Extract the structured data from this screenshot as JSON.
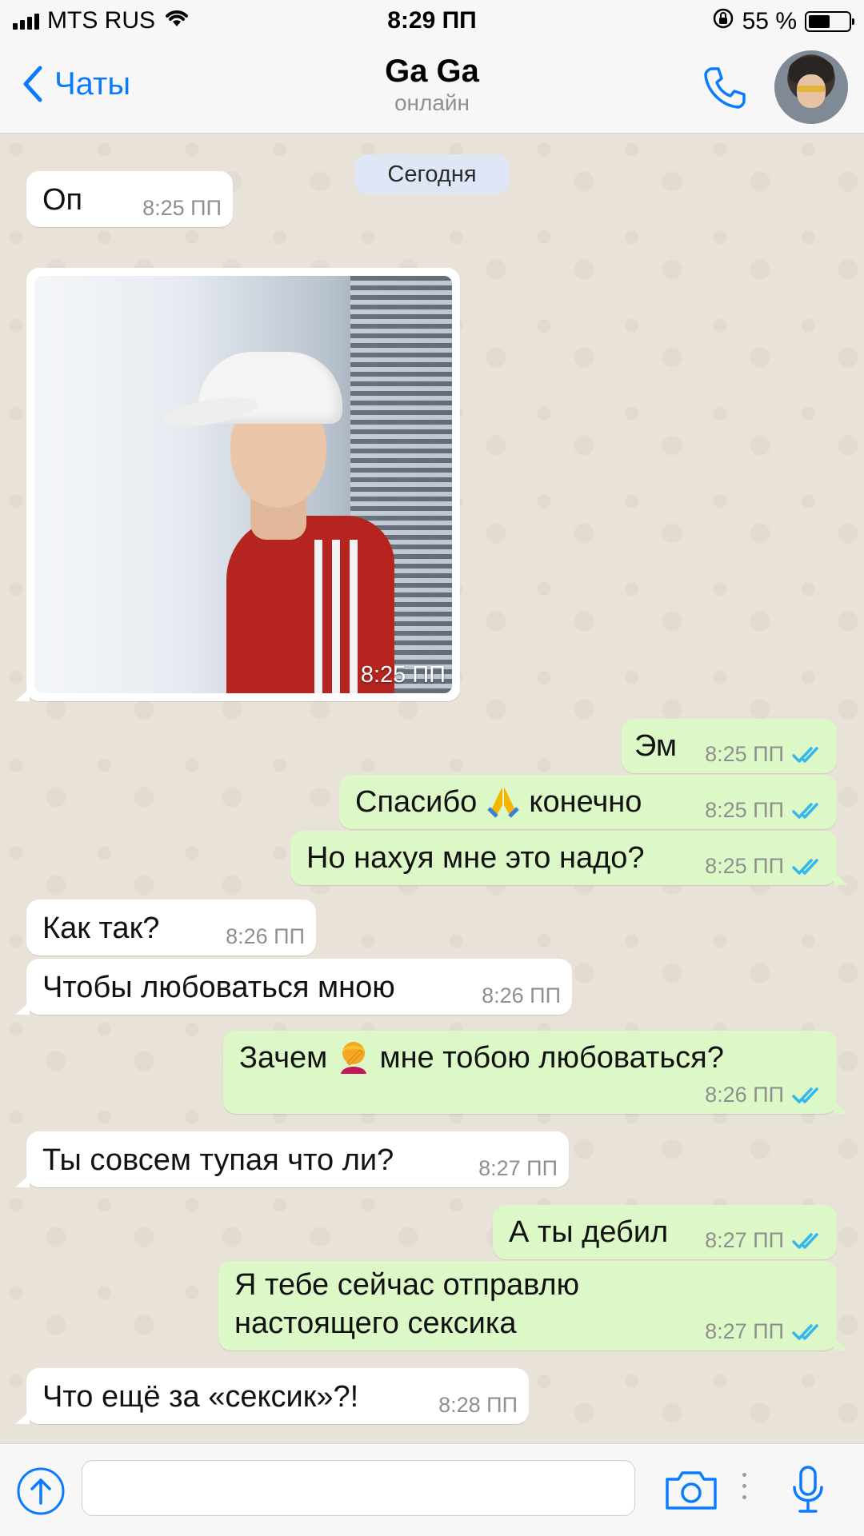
{
  "status_bar": {
    "carrier": "MTS RUS",
    "time": "8:29 ПП",
    "battery_text": "55 %",
    "battery_level": 0.55
  },
  "header": {
    "back_label": "Чаты",
    "chat_name": "Ga Ga",
    "chat_status": "онлайн",
    "icons": [
      "chevron-left-icon",
      "phone-icon",
      "avatar"
    ]
  },
  "chat": {
    "date_separator": "Сегодня",
    "messages": [
      {
        "dir": "in",
        "type": "text",
        "text": "Оп",
        "time": "8:25 ПП"
      },
      {
        "dir": "in",
        "type": "photo",
        "time": "8:25 ПП"
      },
      {
        "dir": "out",
        "type": "text",
        "text": "Эм",
        "time": "8:25 ПП",
        "read": true
      },
      {
        "dir": "out",
        "type": "text",
        "text_before": "Спасибо",
        "emoji": "folded-hands",
        "text_after": "конечно",
        "time": "8:25 ПП",
        "read": true
      },
      {
        "dir": "out",
        "type": "text",
        "text": "Но нахуя мне это надо?",
        "time": "8:25 ПП",
        "read": true
      },
      {
        "dir": "in",
        "type": "text",
        "text": "Как так?",
        "time": "8:26 ПП"
      },
      {
        "dir": "in",
        "type": "text",
        "text": "Чтобы любоваться мною",
        "time": "8:26 ПП"
      },
      {
        "dir": "out",
        "type": "text",
        "text_before": "Зачем",
        "emoji": "facepalm",
        "text_after": "мне тобою любоваться?",
        "time": "8:26 ПП",
        "read": true
      },
      {
        "dir": "in",
        "type": "text",
        "text": "Ты совсем тупая что ли?",
        "time": "8:27 ПП"
      },
      {
        "dir": "out",
        "type": "text",
        "text": "А ты дебил",
        "time": "8:27 ПП",
        "read": true
      },
      {
        "dir": "out",
        "type": "text",
        "lines": [
          "Я тебе сейчас отправлю",
          "настоящего сексика"
        ],
        "time": "8:27 ПП",
        "read": true
      },
      {
        "dir": "in",
        "type": "text",
        "text": "Что ещё за «сексик»?!",
        "time": "8:28 ПП"
      }
    ]
  },
  "input_bar": {
    "placeholder": "",
    "icons": [
      "upload-icon",
      "camera-icon",
      "more-icon",
      "microphone-icon"
    ]
  },
  "colors": {
    "accent": "#0a7aff",
    "incoming": "#ffffff",
    "outgoing": "#dcf8c6",
    "read_ticks": "#34b7f1",
    "background": "#e9e2d8"
  }
}
